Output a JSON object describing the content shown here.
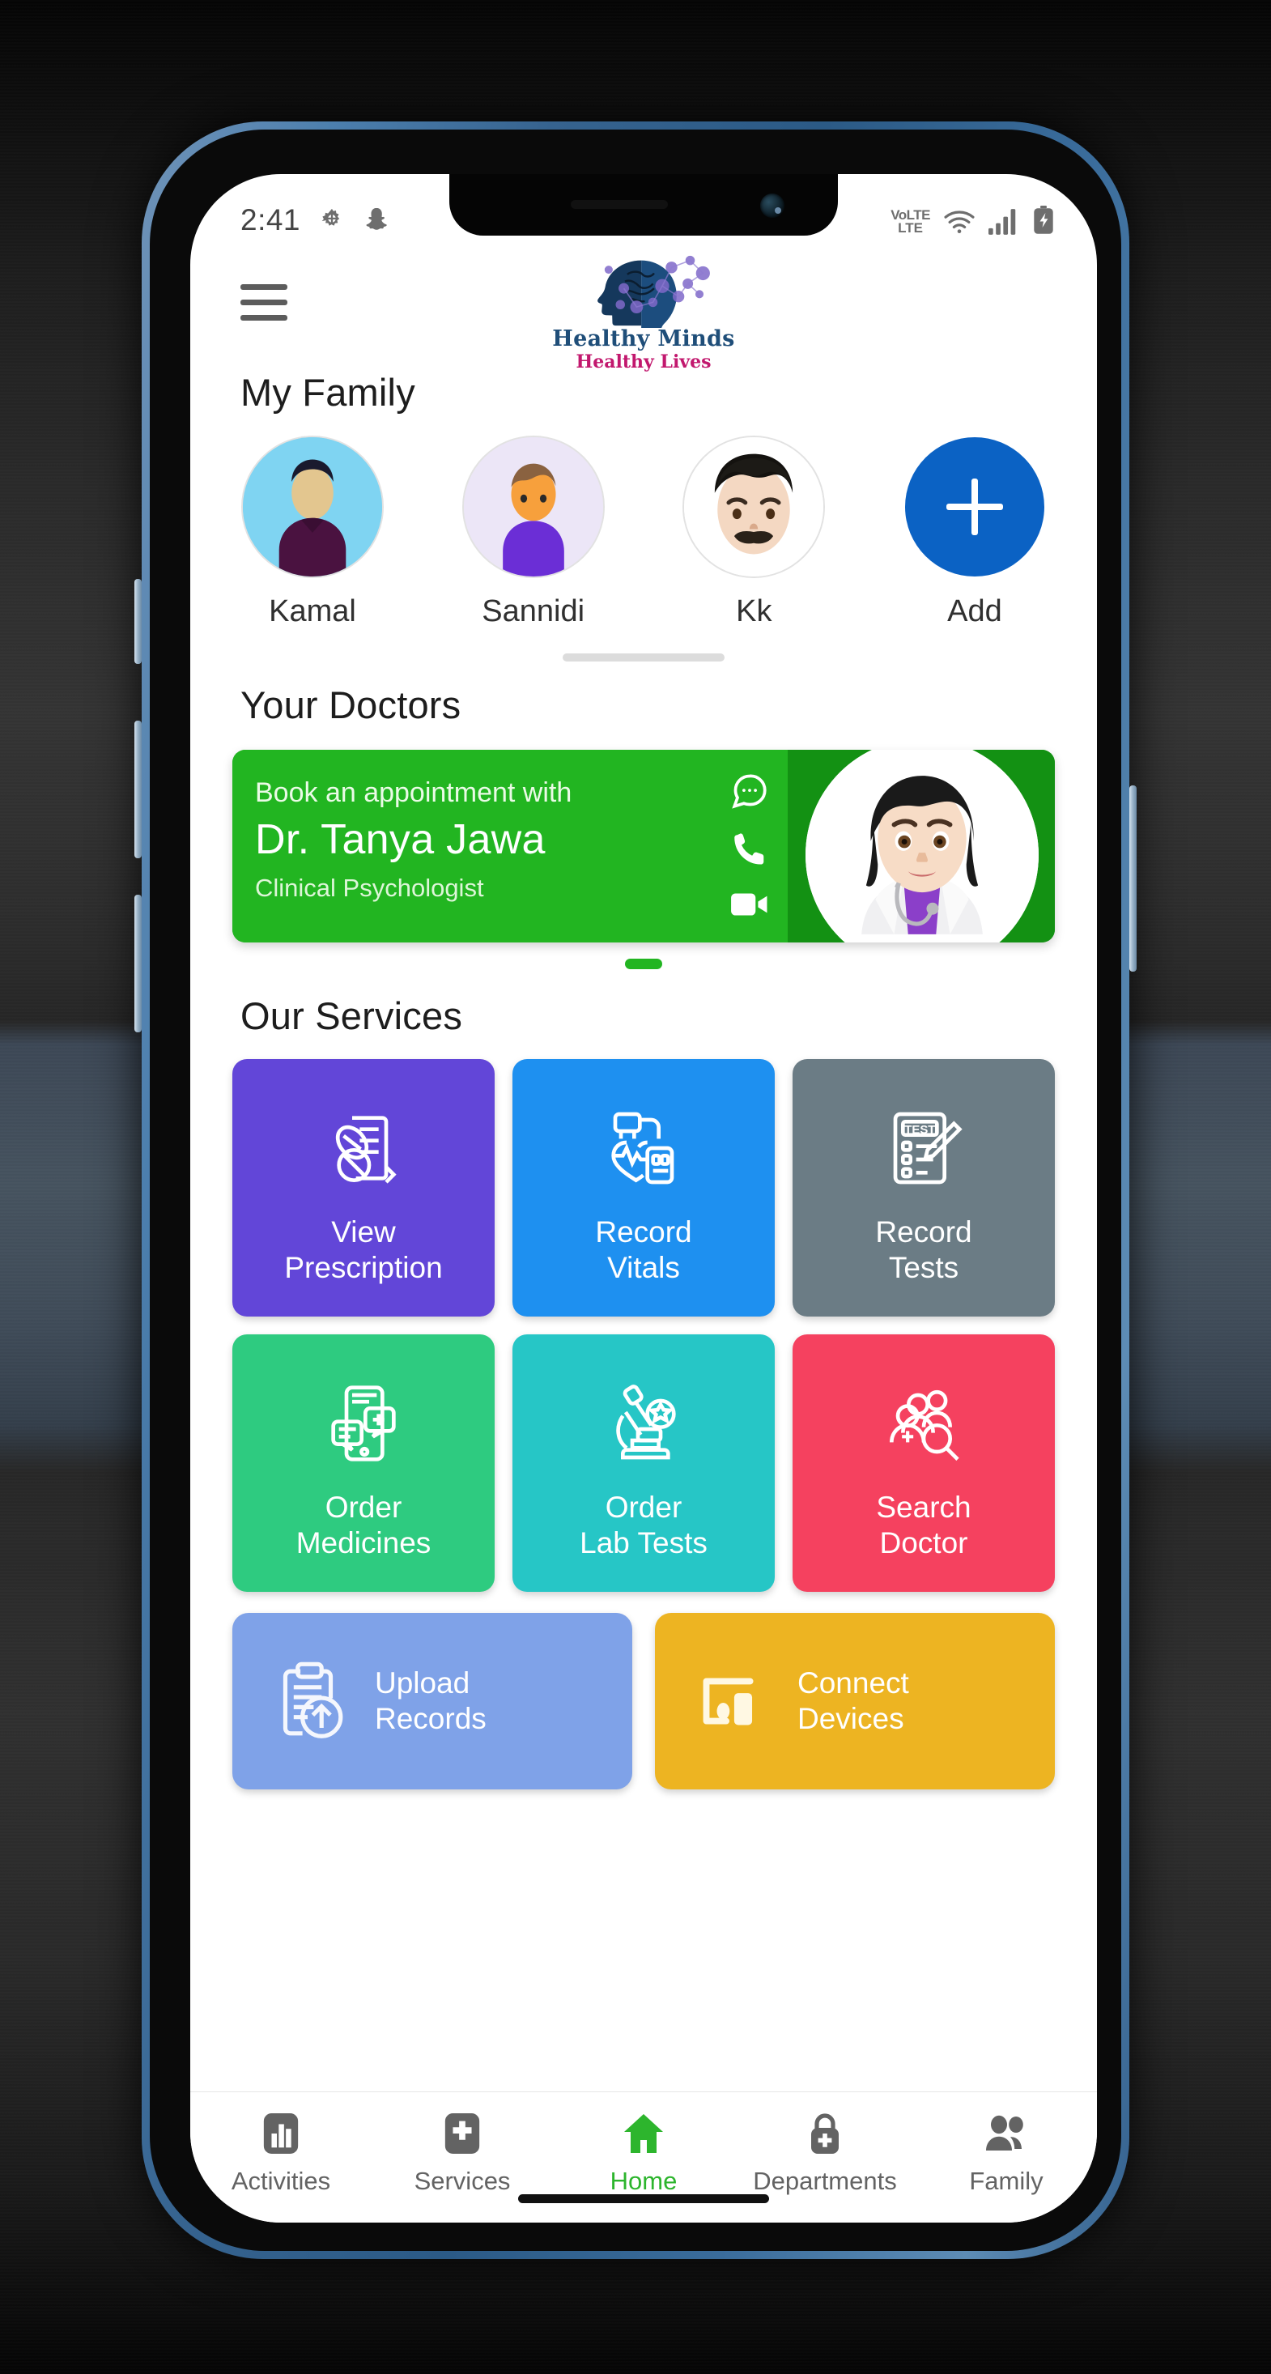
{
  "status_bar": {
    "time": "2:41",
    "left_icons": [
      "gear-icon",
      "snapchat-icon"
    ],
    "network_label_top": "VoLTE",
    "network_label_bottom": "LTE",
    "right_icons": [
      "volte-icon",
      "wifi-icon",
      "signal-icon",
      "battery-charging-icon"
    ]
  },
  "header": {
    "menu_icon": "hamburger-icon",
    "logo": {
      "line1": "Healthy Minds",
      "line2": "Healthy Lives",
      "line1_color": "#1f4e79",
      "line2_color": "#c2186e"
    }
  },
  "family": {
    "title": "My Family",
    "members": [
      {
        "name": "Kamal",
        "avatar": "person-silhouette-avatar",
        "bg": "#7fd4f2"
      },
      {
        "name": "Sannidi",
        "avatar": "boy-avatar",
        "bg": "#ece6f7"
      },
      {
        "name": "Kk",
        "avatar": "man-mustache-avatar",
        "bg": "#ffffff"
      }
    ],
    "add_label": "Add",
    "add_color": "#0b62c4"
  },
  "doctors": {
    "title": "Your Doctors",
    "card": {
      "kicker": "Book an appointment with",
      "name": "Dr. Tanya Jawa",
      "specialty": "Clinical Psychologist",
      "bg_left": "#22b521",
      "bg_right": "#139113",
      "actions": [
        "chat-icon",
        "phone-icon",
        "video-camera-icon"
      ],
      "avatar": "female-doctor-avatar"
    },
    "page_indicator_color": "#22b521"
  },
  "services": {
    "title": "Our Services",
    "tiles": [
      {
        "label": "View\nPrescription",
        "line1": "View",
        "line2": "Prescription",
        "color": "#6246d8",
        "icon": "prescription-pills-icon"
      },
      {
        "label": "Record\nVitals",
        "line1": "Record",
        "line2": "Vitals",
        "color": "#1e90f0",
        "icon": "vitals-monitor-icon"
      },
      {
        "label": "Record\nTests",
        "line1": "Record",
        "line2": "Tests",
        "color": "#6b7c85",
        "icon": "test-clipboard-icon"
      },
      {
        "label": "Order\nMedicines",
        "line1": "Order",
        "line2": "Medicines",
        "color": "#2ecb80",
        "icon": "mobile-pharmacy-icon"
      },
      {
        "label": "Order\nLab Tests",
        "line1": "Order",
        "line2": "Lab Tests",
        "color": "#26c6c6",
        "icon": "microscope-icon"
      },
      {
        "label": "Search\nDoctor",
        "line1": "Search",
        "line2": "Doctor",
        "color": "#f5415f",
        "icon": "doctor-search-icon"
      }
    ],
    "wide_tiles": [
      {
        "line1": "Upload",
        "line2": "Records",
        "color": "#7fa2e8",
        "icon": "clipboard-upload-icon"
      },
      {
        "line1": "Connect",
        "line2": "Devices",
        "color": "#edb422",
        "icon": "connect-devices-icon"
      }
    ]
  },
  "bottom_nav": {
    "active_color": "#2db52d",
    "inactive_color": "#636363",
    "items": [
      {
        "label": "Activities",
        "icon": "bar-chart-icon",
        "active": false
      },
      {
        "label": "Services",
        "icon": "medical-plus-icon",
        "active": false
      },
      {
        "label": "Home",
        "icon": "home-icon",
        "active": true
      },
      {
        "label": "Departments",
        "icon": "lock-plus-icon",
        "active": false
      },
      {
        "label": "Family",
        "icon": "people-icon",
        "active": false
      }
    ]
  }
}
